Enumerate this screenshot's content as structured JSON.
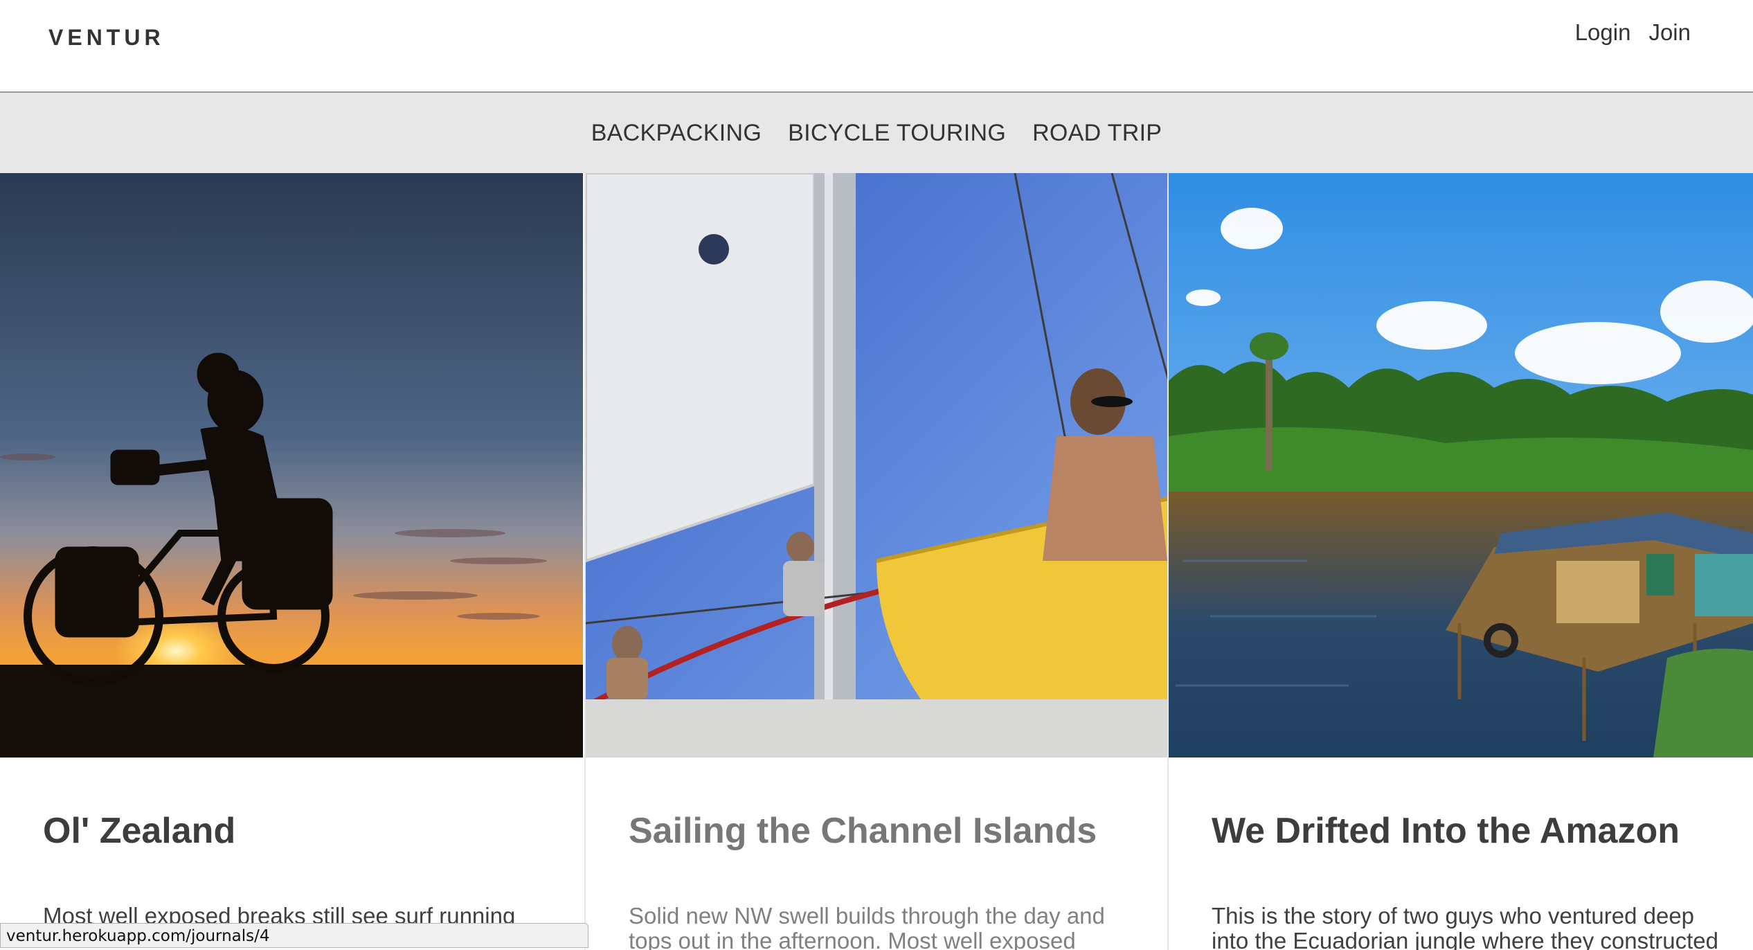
{
  "header": {
    "logo": "VENTUR",
    "login_label": "Login",
    "join_label": "Join"
  },
  "categories": [
    "BACKPACKING",
    "BICYCLE TOURING",
    "ROAD TRIP"
  ],
  "cards": [
    {
      "title": "Ol' Zealand",
      "excerpt": "Most well exposed breaks still see surf running",
      "image": "cyclist-silhouette-sunset-photo"
    },
    {
      "title": "Sailing the Channel Islands",
      "excerpt": "Solid new NW swell builds through the day and tops out in the afternoon. Most well exposed",
      "image": "sailboat-crew-photo"
    },
    {
      "title": "We Drifted Into the Amazon",
      "excerpt": "This is the story of two guys who ventured deep into the Ecuadorian jungle where they constructed",
      "image": "jungle-river-raft-photo"
    }
  ],
  "status_bar": {
    "url": "ventur.herokuapp.com/journals/4"
  },
  "colors": {
    "nav_background": "#e7e7e7",
    "text": "#404040",
    "muted_title": "#777777"
  }
}
